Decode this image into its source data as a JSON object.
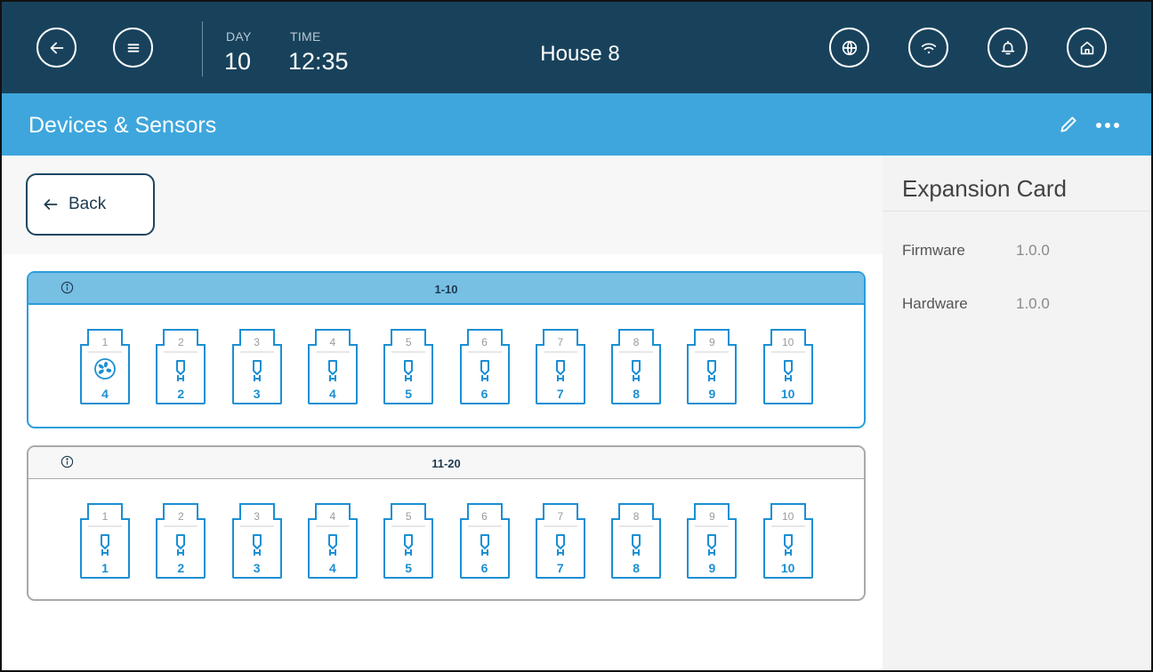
{
  "topbar": {
    "day_label": "DAY",
    "day_value": "10",
    "time_label": "TIME",
    "time_value": "12:35",
    "title": "House 8",
    "icons": [
      "back-arrow-icon",
      "menu-icon",
      "globe-icon",
      "wifi-icon",
      "bell-icon",
      "home-icon"
    ]
  },
  "subheader": {
    "title": "Devices & Sensors",
    "icons": [
      "pencil-icon",
      "more-dots-icon"
    ]
  },
  "back_button": {
    "label": "Back"
  },
  "groups": [
    {
      "range": "1-10",
      "state": "active",
      "slots": [
        {
          "number": "1",
          "icon": "fan-icon",
          "value": "4"
        },
        {
          "number": "2",
          "icon": "relay-icon",
          "value": "2"
        },
        {
          "number": "3",
          "icon": "relay-icon",
          "value": "3"
        },
        {
          "number": "4",
          "icon": "relay-icon",
          "value": "4"
        },
        {
          "number": "5",
          "icon": "relay-icon",
          "value": "5"
        },
        {
          "number": "6",
          "icon": "relay-icon",
          "value": "6"
        },
        {
          "number": "7",
          "icon": "relay-icon",
          "value": "7"
        },
        {
          "number": "8",
          "icon": "relay-icon",
          "value": "8"
        },
        {
          "number": "9",
          "icon": "relay-icon",
          "value": "9"
        },
        {
          "number": "10",
          "icon": "relay-icon",
          "value": "10"
        }
      ]
    },
    {
      "range": "11-20",
      "state": "inactive",
      "slots": [
        {
          "number": "1",
          "icon": "relay-icon",
          "value": "1"
        },
        {
          "number": "2",
          "icon": "relay-icon",
          "value": "2"
        },
        {
          "number": "3",
          "icon": "relay-icon",
          "value": "3"
        },
        {
          "number": "4",
          "icon": "relay-icon",
          "value": "4"
        },
        {
          "number": "5",
          "icon": "relay-icon",
          "value": "5"
        },
        {
          "number": "6",
          "icon": "relay-icon",
          "value": "6"
        },
        {
          "number": "7",
          "icon": "relay-icon",
          "value": "7"
        },
        {
          "number": "8",
          "icon": "relay-icon",
          "value": "8"
        },
        {
          "number": "9",
          "icon": "relay-icon",
          "value": "9"
        },
        {
          "number": "10",
          "icon": "relay-icon",
          "value": "10"
        }
      ]
    }
  ],
  "info_panel": {
    "title": "Expansion Card",
    "fields": [
      {
        "label": "Firmware",
        "value": "1.0.0"
      },
      {
        "label": "Hardware",
        "value": "1.0.0"
      }
    ]
  },
  "colors": {
    "topbar": "#18425c",
    "subheader": "#3ea6dc",
    "accent": "#1b8fd3",
    "active_group_header": "#78bfe4",
    "inactive_border": "#a9a9a9"
  }
}
